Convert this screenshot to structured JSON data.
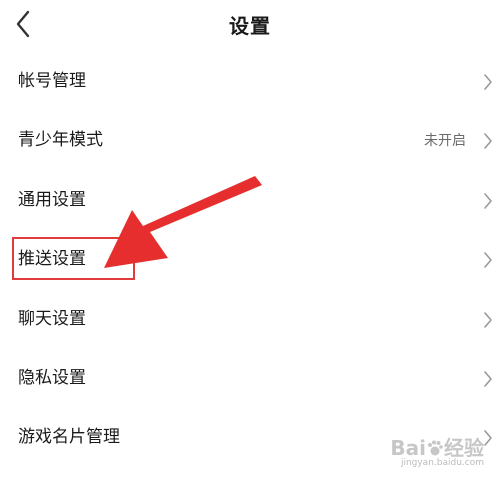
{
  "header": {
    "title": "设置"
  },
  "settings": {
    "items": [
      {
        "label": "帐号管理",
        "value": ""
      },
      {
        "label": "青少年模式",
        "value": "未开启"
      },
      {
        "label": "通用设置",
        "value": ""
      },
      {
        "label": "推送设置",
        "value": ""
      },
      {
        "label": "聊天设置",
        "value": ""
      },
      {
        "label": "隐私设置",
        "value": ""
      },
      {
        "label": "游戏名片管理",
        "value": ""
      }
    ]
  },
  "annotation": {
    "highlighted_item": "推送设置",
    "color": "#e23b3b"
  },
  "watermark": {
    "logo_text": "Bai",
    "logo_text_cn": "经验",
    "url": "jingyan.baidu.com"
  }
}
